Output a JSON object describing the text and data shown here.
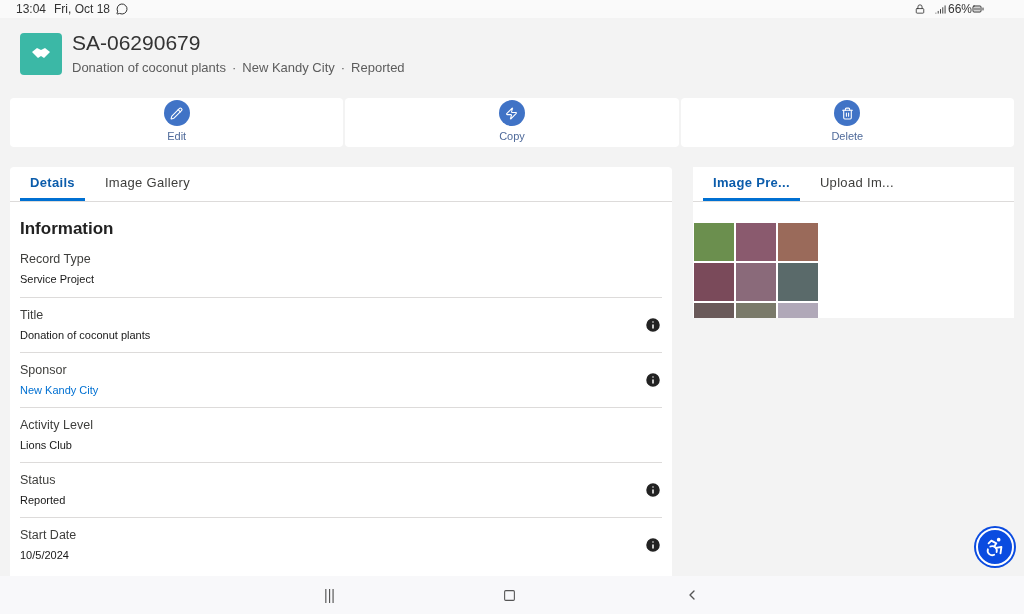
{
  "status_bar": {
    "time": "13:04",
    "date": "Fri, Oct 18",
    "battery": "66%"
  },
  "header": {
    "title": "SA-06290679",
    "subtitle": [
      "Donation of coconut plants",
      "New Kandy City",
      "Reported"
    ],
    "separator": "·"
  },
  "actions": [
    {
      "label": "Edit",
      "kind": "edit"
    },
    {
      "label": "Copy",
      "kind": "copy"
    },
    {
      "label": "Delete",
      "kind": "delete"
    }
  ],
  "left_tabs": [
    {
      "label": "Details",
      "selected": true
    },
    {
      "label": "Image Gallery",
      "selected": false
    }
  ],
  "section_title": "Information",
  "fields": [
    {
      "label": "Record Type",
      "value": "Service Project",
      "info": false,
      "kind": "text"
    },
    {
      "label": "Title",
      "value": "Donation of coconut plants",
      "info": true,
      "kind": "text"
    },
    {
      "label": "Sponsor",
      "value": "New Kandy City",
      "info": true,
      "kind": "link"
    },
    {
      "label": "Activity Level",
      "value": "Lions Club",
      "info": false,
      "kind": "text"
    },
    {
      "label": "Status",
      "value": "Reported",
      "info": true,
      "kind": "text"
    },
    {
      "label": "Start Date",
      "value": "10/5/2024",
      "info": true,
      "kind": "text"
    }
  ],
  "right_tabs": [
    {
      "label": "Image Pre...",
      "selected": true
    },
    {
      "label": "Upload Im...",
      "selected": false
    }
  ],
  "nav_bar": {
    "recents": "|||"
  }
}
